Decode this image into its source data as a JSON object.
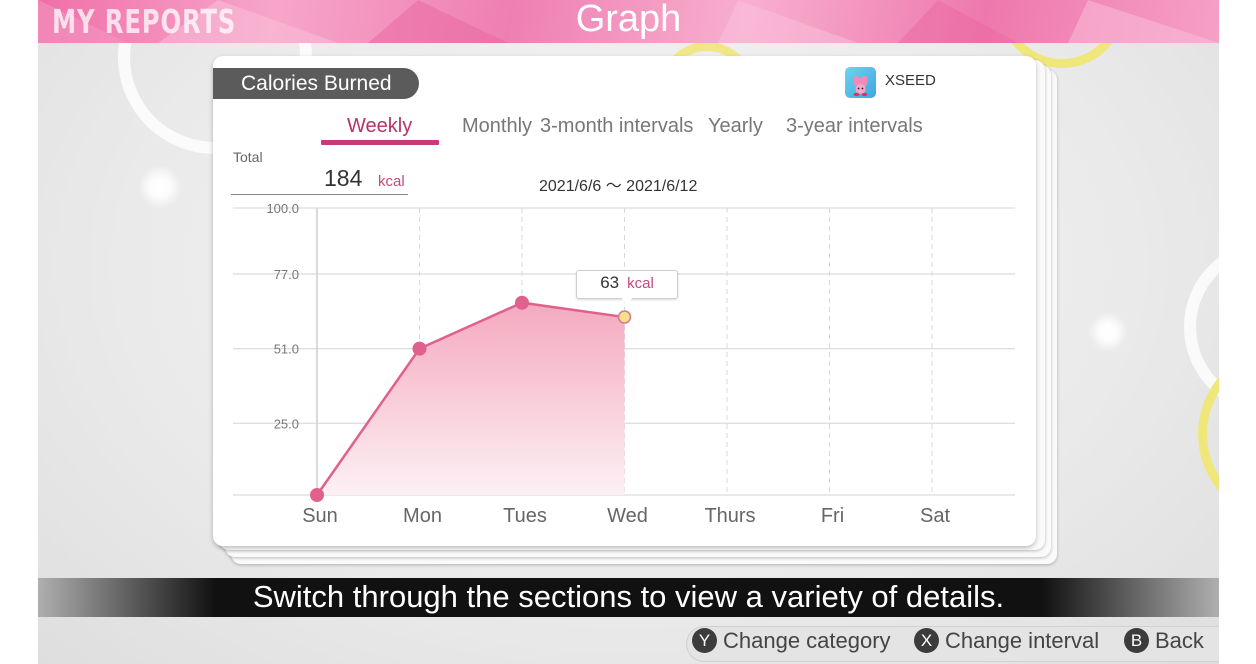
{
  "header": {
    "section": "MY REPORTS",
    "title": "Graph"
  },
  "card": {
    "category": "Calories Burned",
    "user_name": "XSEED",
    "tabs": [
      {
        "label": "Weekly",
        "active": true
      },
      {
        "label": "Monthly",
        "active": false
      },
      {
        "label": "3-month intervals",
        "active": false
      },
      {
        "label": "Yearly",
        "active": false
      },
      {
        "label": "3-year intervals",
        "active": false
      }
    ],
    "total_label": "Total",
    "total_value": "184",
    "total_unit": "kcal",
    "date_range": "2021/6/6 ～ 2021/6/12",
    "tooltip": {
      "value": "63",
      "unit": "kcal"
    }
  },
  "chart_data": {
    "type": "area",
    "categories": [
      "Sun",
      "Mon",
      "Tues",
      "Wed",
      "Thurs",
      "Fri",
      "Sat"
    ],
    "values": [
      0,
      51,
      67,
      62,
      null,
      null,
      null
    ],
    "yticks": [
      "25.0",
      "51.0",
      "77.0",
      "100.0"
    ],
    "ylim": [
      0,
      100
    ],
    "highlight_index": 3,
    "grid": true,
    "colors": {
      "line": "#e0608e",
      "fill_top": "#f4a9bf",
      "fill_bottom": "#fdf0f4",
      "highlight": "#f4e08a"
    }
  },
  "help_text": "Switch through the sections to view a variety of details.",
  "controls": [
    {
      "button": "Y",
      "label": "Change category"
    },
    {
      "button": "X",
      "label": "Change interval"
    },
    {
      "button": "B",
      "label": "Back"
    }
  ]
}
